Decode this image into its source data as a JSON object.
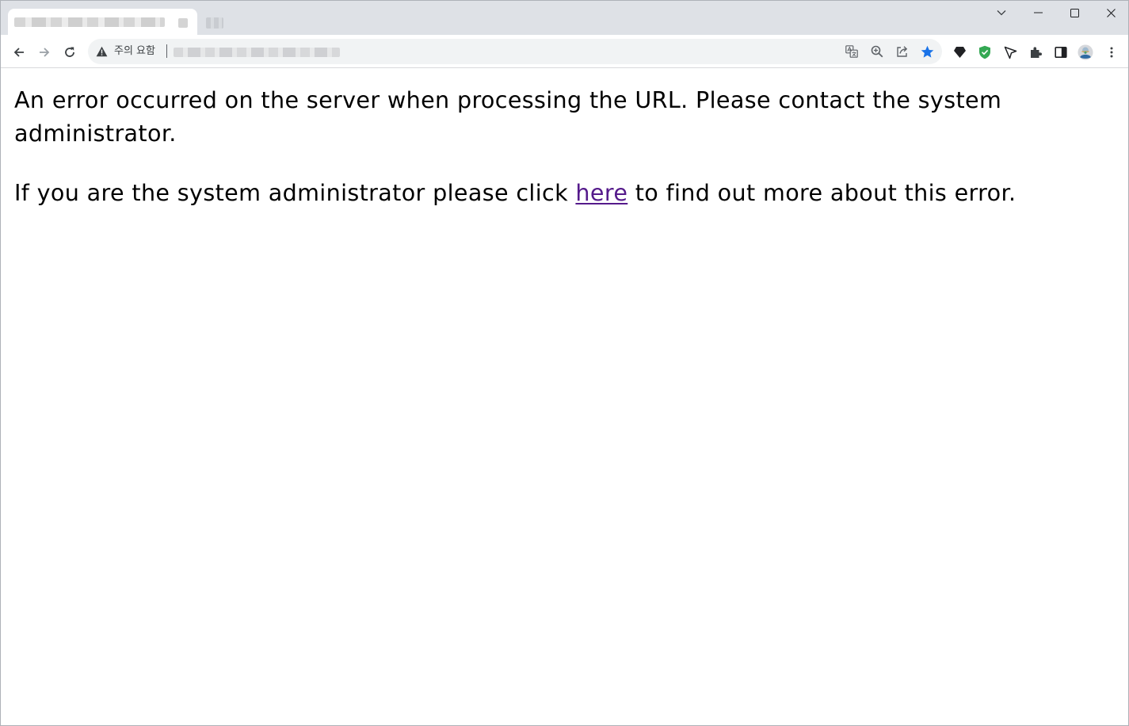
{
  "browser": {
    "security_label": "주의 요함",
    "colors": {
      "tabstrip": "#dee1e6",
      "omnibox": "#f1f3f4",
      "bookmark_star": "#1a73e8",
      "shield_green": "#34a853",
      "link_visited": "#551a8b"
    },
    "window_controls": [
      "chevron-down-icon",
      "minimize-icon",
      "maximize-icon",
      "close-icon"
    ],
    "nav_icons": [
      "back-arrow-icon",
      "forward-arrow-icon",
      "reload-icon"
    ],
    "omnibox_icons": [
      "translate-icon",
      "zoom-icon",
      "share-icon",
      "bookmark-star-icon"
    ],
    "extension_icons": [
      "extension-diamond-icon",
      "extension-shield-icon",
      "extension-cursor-icon",
      "extensions-puzzle-icon",
      "side-panel-icon",
      "profile-avatar-icon",
      "menu-kebab-icon"
    ]
  },
  "page": {
    "error_message": "An error occurred on the server when processing the URL. Please contact the system administrator.",
    "admin_prefix": "If you are the system administrator please click ",
    "admin_link": "here",
    "admin_suffix": " to find out more about this error."
  }
}
